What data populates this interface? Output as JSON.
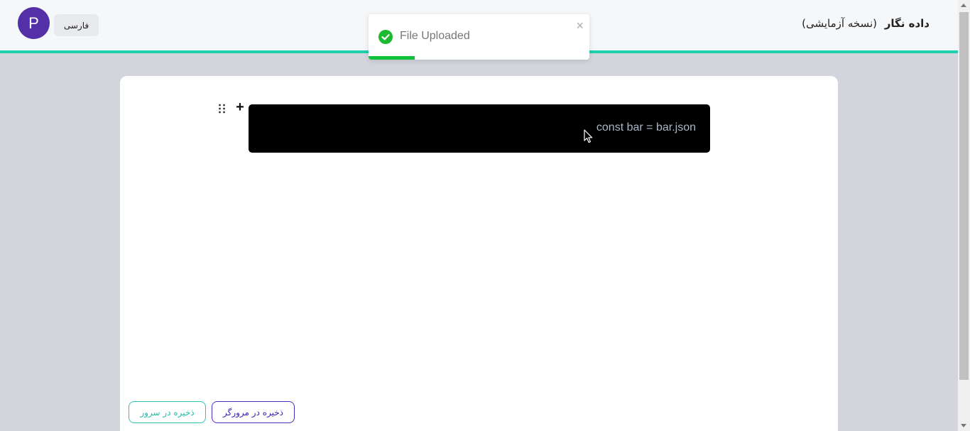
{
  "header": {
    "brand_name": "داده نگار",
    "brand_tag": "(نسخه آزمایشی)",
    "language_label": "فارسی",
    "avatar_letter": "P",
    "accent_color": "#1fcfb0"
  },
  "toast": {
    "message": "File Uploaded",
    "close_symbol": "×",
    "status_icon": "check-circle-icon",
    "progress": 0.21,
    "progress_color": "#12c13a"
  },
  "editor": {
    "add_symbol": "+",
    "drag_icon": "drag-handle-icon",
    "code_text": "const bar = bar.json"
  },
  "actions": {
    "save_browser_label": "ذخیره در مرورگر",
    "save_server_label": "ذخیره در سرور"
  }
}
